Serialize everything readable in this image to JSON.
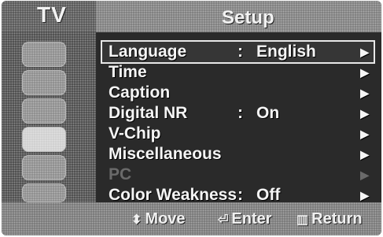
{
  "header": {
    "section_label": "TV",
    "menu_title": "Setup"
  },
  "sidebar": {
    "icons": [
      {
        "name": "picture-icon"
      },
      {
        "name": "sound-icon"
      },
      {
        "name": "channel-icon"
      },
      {
        "name": "setup-icon"
      },
      {
        "name": "input-icon"
      },
      {
        "name": "application-icon"
      }
    ]
  },
  "menu": {
    "items": [
      {
        "label": "Language",
        "separator": ":",
        "value": "English",
        "arrow": "▶"
      },
      {
        "label": "Time",
        "separator": "",
        "value": "",
        "arrow": "▶"
      },
      {
        "label": "Caption",
        "separator": "",
        "value": "",
        "arrow": "▶"
      },
      {
        "label": "Digital NR",
        "separator": ":",
        "value": "On",
        "arrow": "▶"
      },
      {
        "label": "V-Chip",
        "separator": "",
        "value": "",
        "arrow": "▶"
      },
      {
        "label": "Miscellaneous",
        "separator": "",
        "value": "",
        "arrow": "▶"
      },
      {
        "label": "PC",
        "separator": "",
        "value": "",
        "arrow": "▶"
      },
      {
        "label": "Color Weakness",
        "separator": ":",
        "value": "Off",
        "arrow": "▶"
      }
    ],
    "selected_index": 0,
    "disabled_index": 6
  },
  "footer": {
    "move_glyph": "⬍",
    "move_label": "Move",
    "enter_glyph": "⏎",
    "enter_label": "Enter",
    "return_glyph": "▥",
    "return_label": "Return"
  }
}
